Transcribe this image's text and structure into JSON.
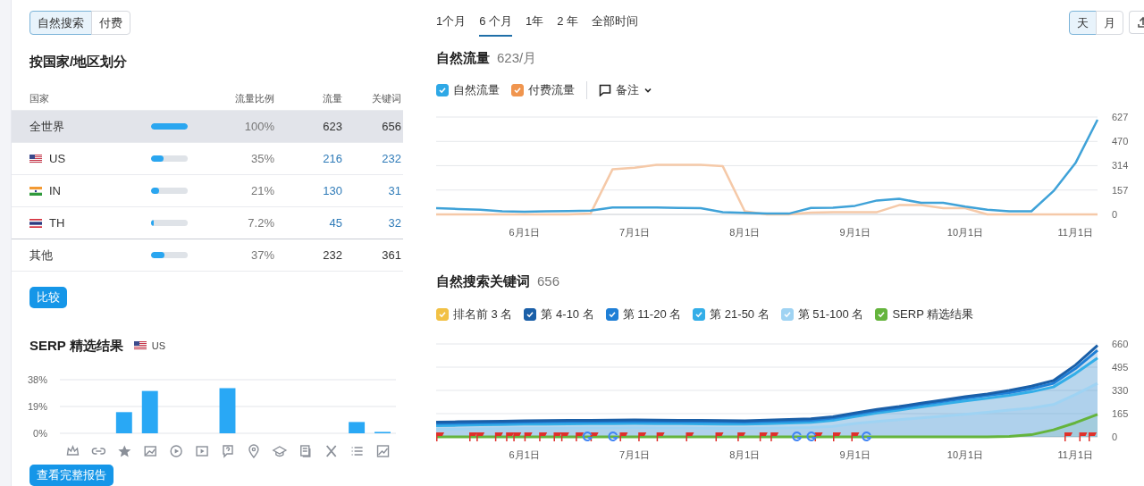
{
  "source_toggle": [
    {
      "label": "自然搜索",
      "selected": true
    },
    {
      "label": "付费",
      "selected": false
    }
  ],
  "by_country": {
    "title": "按国家/地区划分",
    "columns": [
      "国家",
      "流量比例",
      "流量",
      "关键词"
    ],
    "rows": [
      {
        "name": "全世界",
        "level": 1.0,
        "share": "100%",
        "traffic": "623",
        "keywords": "656",
        "selected": true,
        "linked": false
      },
      {
        "name": "US",
        "kind": "country",
        "level": 0.35,
        "share": "35%",
        "traffic": "216",
        "keywords": "232",
        "selected": false,
        "linked": true
      },
      {
        "name": "IN",
        "kind": "country",
        "level": 0.21,
        "share": "21%",
        "traffic": "130",
        "keywords": "31",
        "selected": false,
        "linked": true
      },
      {
        "name": "TH",
        "kind": "country",
        "level": 0.072,
        "share": "7.2%",
        "traffic": "45",
        "keywords": "32",
        "selected": false,
        "linked": true
      },
      {
        "name": "其他",
        "level": 0.37,
        "share": "37%",
        "traffic": "232",
        "keywords": "361",
        "selected": false,
        "linked": false
      }
    ],
    "compare_button": "比较"
  },
  "serp": {
    "title": "SERP 精选结果",
    "country": "US",
    "chart_data": {
      "type": "bar",
      "values": [
        0,
        0,
        15,
        30,
        0,
        0,
        32,
        0,
        0,
        0,
        0,
        8,
        1
      ],
      "ylim": [
        0,
        38
      ],
      "yticks": [
        {
          "value": 0,
          "label": "0%"
        },
        {
          "value": 19,
          "label": "19%"
        },
        {
          "value": 38,
          "label": "38%"
        }
      ]
    },
    "report_button": "查看完整报告"
  },
  "periods": [
    {
      "label": "1个月",
      "selected": false
    },
    {
      "label": "6 个月",
      "selected": true
    },
    {
      "label": "1年",
      "selected": false
    },
    {
      "label": "2 年",
      "selected": false
    },
    {
      "label": "全部时间",
      "selected": false
    }
  ],
  "granularity": [
    {
      "label": "天",
      "selected": true
    },
    {
      "label": "月",
      "selected": false
    }
  ],
  "traffic": {
    "title": "自然流量",
    "value": "623/月",
    "legend": [
      {
        "label": "自然流量",
        "checked": true,
        "color": "#2ea8e6"
      },
      {
        "label": "付费流量",
        "checked": true,
        "color": "#f0954e"
      }
    ],
    "notes": "备注",
    "chart_data": {
      "type": "line",
      "categories": [
        null,
        null,
        null,
        null,
        "6月1日",
        null,
        null,
        null,
        null,
        "7月1日",
        null,
        null,
        null,
        null,
        "8月1日",
        null,
        null,
        null,
        null,
        "9月1日",
        null,
        null,
        null,
        null,
        "10月1日",
        null,
        null,
        null,
        null,
        "11月1日",
        null
      ],
      "series": [
        {
          "color": "#3fa2d8",
          "values": [
            40,
            35,
            30,
            20,
            18,
            20,
            22,
            25,
            45,
            45,
            45,
            42,
            40,
            15,
            10,
            6,
            5,
            42,
            44,
            55,
            90,
            100,
            75,
            75,
            50,
            30,
            20,
            20,
            150,
            330,
            610
          ]
        },
        {
          "color": "#f5c9a8",
          "values": [
            0,
            0,
            0,
            0,
            0,
            0,
            0,
            5,
            290,
            300,
            320,
            320,
            320,
            310,
            20,
            0,
            0,
            12,
            15,
            15,
            15,
            60,
            60,
            40,
            40,
            0,
            0,
            0,
            0,
            0,
            0
          ]
        }
      ],
      "ylim": [
        0,
        627
      ],
      "yticks": [
        0,
        157,
        314,
        470,
        627
      ],
      "grid": true
    }
  },
  "keywords": {
    "title": "自然搜索关键词",
    "value": "656",
    "legend": [
      {
        "label": "排名前 3 名",
        "checked": true,
        "color": "#f2c144"
      },
      {
        "label": "第 4-10 名",
        "checked": true,
        "color": "#1a5fa8"
      },
      {
        "label": "第 11-20 名",
        "checked": true,
        "color": "#1f7fd6"
      },
      {
        "label": "第 21-50 名",
        "checked": true,
        "color": "#33aee8"
      },
      {
        "label": "第 51-100 名",
        "checked": true,
        "color": "#9fd3f3"
      },
      {
        "label": "SERP 精选结果",
        "checked": true,
        "color": "#64b43c"
      }
    ],
    "chart_data": {
      "type": "area",
      "categories": [
        null,
        null,
        null,
        null,
        "6月1日",
        null,
        null,
        null,
        null,
        "7月1日",
        null,
        null,
        null,
        null,
        "8月1日",
        null,
        null,
        null,
        null,
        "9月1日",
        null,
        null,
        null,
        null,
        "10月1日",
        null,
        null,
        null,
        null,
        "11月1日",
        null
      ],
      "series": [
        {
          "color": "#1a5fa8",
          "values": [
            105,
            107,
            110,
            112,
            115,
            116,
            117,
            118,
            119,
            120,
            119,
            118,
            117,
            116,
            115,
            119,
            123,
            128,
            143,
            170,
            195,
            215,
            240,
            262,
            285,
            305,
            330,
            360,
            400,
            510,
            650
          ]
        },
        {
          "color": "#1f7fd6",
          "values": [
            95,
            97,
            100,
            102,
            105,
            106,
            107,
            108,
            109,
            110,
            109,
            108,
            107,
            106,
            105,
            109,
            113,
            118,
            133,
            160,
            185,
            205,
            230,
            252,
            275,
            295,
            315,
            343,
            380,
            485,
            615
          ]
        },
        {
          "color": "#33aee8",
          "values": [
            80,
            82,
            85,
            87,
            90,
            91,
            92,
            93,
            94,
            95,
            94,
            93,
            92,
            91,
            90,
            94,
            98,
            103,
            118,
            145,
            170,
            190,
            213,
            235,
            255,
            275,
            295,
            320,
            355,
            450,
            560
          ]
        },
        {
          "color": "#9fd3f3",
          "values": [
            55,
            56,
            58,
            59,
            60,
            61,
            62,
            63,
            64,
            65,
            64,
            63,
            62,
            61,
            60,
            62,
            64,
            67,
            75,
            95,
            110,
            122,
            135,
            148,
            160,
            175,
            190,
            205,
            230,
            300,
            380
          ]
        },
        {
          "color": "#64b43c",
          "values": [
            0,
            0,
            0,
            0,
            0,
            0,
            0,
            0,
            0,
            0,
            0,
            0,
            0,
            0,
            0,
            0,
            0,
            0,
            0,
            0,
            0,
            0,
            0,
            0,
            0,
            0,
            3,
            15,
            50,
            100,
            160
          ]
        }
      ],
      "ylim": [
        0,
        660
      ],
      "yticks": [
        0,
        165,
        330,
        495,
        660
      ],
      "grid": true
    }
  }
}
